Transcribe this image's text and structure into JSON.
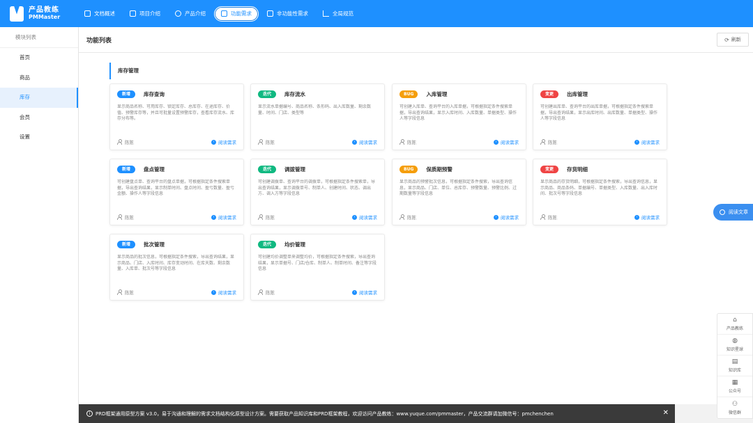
{
  "app": {
    "logo_line1": "产品教练",
    "logo_line2": "PMMaster"
  },
  "nav": [
    {
      "label": "文档概述",
      "icon": "menu-icon"
    },
    {
      "label": "项目介绍",
      "icon": "doc-icon"
    },
    {
      "label": "产品介绍",
      "icon": "user-icon"
    },
    {
      "label": "功能需求",
      "icon": "calendar-icon",
      "active": true
    },
    {
      "label": "非功能性需求",
      "icon": "grid-icon"
    },
    {
      "label": "全局规范",
      "icon": "chart-icon"
    }
  ],
  "sidebar": {
    "title": "模块列表",
    "items": [
      {
        "label": "首页"
      },
      {
        "label": "商品"
      },
      {
        "label": "库存",
        "active": true
      },
      {
        "label": "会员"
      },
      {
        "label": "设置"
      }
    ]
  },
  "main": {
    "title": "功能列表",
    "refresh_label": "刷新"
  },
  "section": {
    "title": "库存管理"
  },
  "cards": [
    {
      "badge": "新增",
      "badge_type": "new",
      "title": "库存查询",
      "desc": "显示商品名称、可用库存、锁定库存、总库存、在途库存、价值、预警库存等，并且可批量设置预警库存，查看库存流水、库存分布等。",
      "author": "陈陈",
      "link": "阅读需求"
    },
    {
      "badge": "迭代",
      "badge_type": "iter",
      "title": "库存流水",
      "desc": "显示流水单据编号、商品名称、条形码、出入库数量、剩余数量、时间、门店、类型等",
      "author": "陈陈",
      "link": "阅读需求"
    },
    {
      "badge": "BUG",
      "badge_type": "bug",
      "title": "入库管理",
      "desc": "可创建入库单、查询平台的入库单据，可根据指定条件搜索单据，导出查询结果，显示入库时间、入库数量、单据类型、操作人等字段信息",
      "author": "陈陈",
      "link": "阅读需求"
    },
    {
      "badge": "变更",
      "badge_type": "chg",
      "title": "出库管理",
      "desc": "可创建出库单、查询平台的出库单据，可根据指定条件搜索单据，导出查询结果，显示出库时间、出库数量、单据类型、操作人等字段信息",
      "author": "陈陈",
      "link": "阅读需求"
    },
    {
      "badge": "新增",
      "badge_type": "new",
      "title": "盘点管理",
      "desc": "可创建盘点单、查询平台的盘点单据，可根据指定条件搜索单据，导出查询结果，显示制单时间、盘点时间、盈亏数量、盈亏金额、操作人等字段信息",
      "author": "陈陈",
      "link": "阅读需求"
    },
    {
      "badge": "迭代",
      "badge_type": "iter",
      "title": "调拨管理",
      "desc": "可创建调拨单、查询平台的调拨单，可根据指定条件搜索单，导出查询结果，显示调拨单号、制单人、创建时间、状态、调出方、调入方等字段信息",
      "author": "陈陈",
      "link": "阅读需求"
    },
    {
      "badge": "BUG",
      "badge_type": "bug",
      "title": "保质期预警",
      "desc": "显示商品的预警批次信息，可根据指定条件搜索，导出查询信息，显示商品、门店、单位、总库存、预警数量、预警比例、过期数量等字段信息",
      "author": "陈陈",
      "link": "阅读需求"
    },
    {
      "badge": "变更",
      "badge_type": "chg",
      "title": "存货明细",
      "desc": "显示商品的存货明细，可根据指定条件搜索，导出查询信息，显示商品、商品条码、单据编号、单据类型、入库数量、出入库时间、批次号等字段信息",
      "author": "陈陈",
      "link": "阅读需求"
    },
    {
      "badge": "新增",
      "badge_type": "new",
      "title": "批次管理",
      "desc": "显示商品的批次信息，可根据指定条件搜索，导出查询结果，显示商品、门店、入库时间、库存变动时间、在库天数、剩余数量、入库单、批次号等字段信息",
      "author": "陈陈",
      "link": "阅读需求"
    },
    {
      "badge": "迭代",
      "badge_type": "iter",
      "title": "均价管理",
      "desc": "可创建均价调整单来调整均价，可根据指定条件搜索，导出查询结果，显示单据号、门店/仓库、制单人、制单时间、备注等字段信息",
      "author": "陈陈",
      "link": "阅读需求"
    }
  ],
  "float": {
    "read_label": "阅读文章"
  },
  "tools": [
    {
      "label": "产品教练",
      "icon": "home-icon"
    },
    {
      "label": "知识星球",
      "icon": "globe-icon"
    },
    {
      "label": "知识库",
      "icon": "book-icon"
    },
    {
      "label": "公众号",
      "icon": "qr-icon"
    },
    {
      "label": "微信群",
      "icon": "group-icon"
    }
  ],
  "footer": {
    "text": "PRD框架通用原型方案 v3.0，易于沟通和理解的需求文档结构化原型设计方案。需要获取产品知识库和PRD框架教程，欢迎访问产品教练：www.yuque.com/pmmaster，产品交流群请加微信号：pmchenchen"
  }
}
